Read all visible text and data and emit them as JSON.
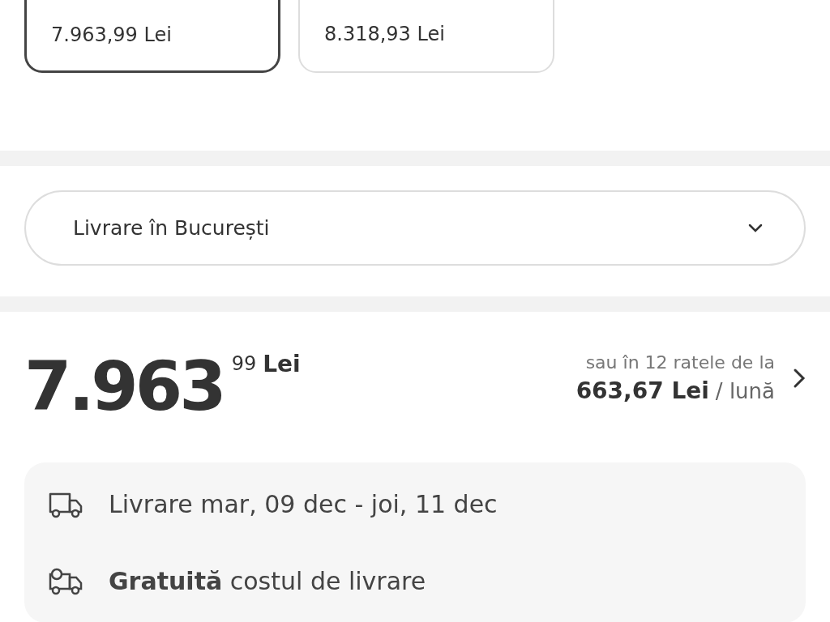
{
  "price_options": [
    {
      "price": "7.963,99 Lei",
      "selected": true
    },
    {
      "price": "8.318,93 Lei",
      "selected": false
    }
  ],
  "delivery_location": {
    "value": "Livrare în București"
  },
  "price": {
    "integer": "7.963",
    "decimals": "99",
    "currency": "Lei"
  },
  "installments": {
    "text": "sau în 12 ratele de la",
    "amount": "663,67 Lei",
    "unit": "/ lună"
  },
  "delivery_info": [
    {
      "kind": "truck",
      "text": "Livrare mar, 09 dec - joi, 11 dec"
    },
    {
      "kind": "free",
      "text": "**Gratuită** costul de livrare"
    }
  ]
}
